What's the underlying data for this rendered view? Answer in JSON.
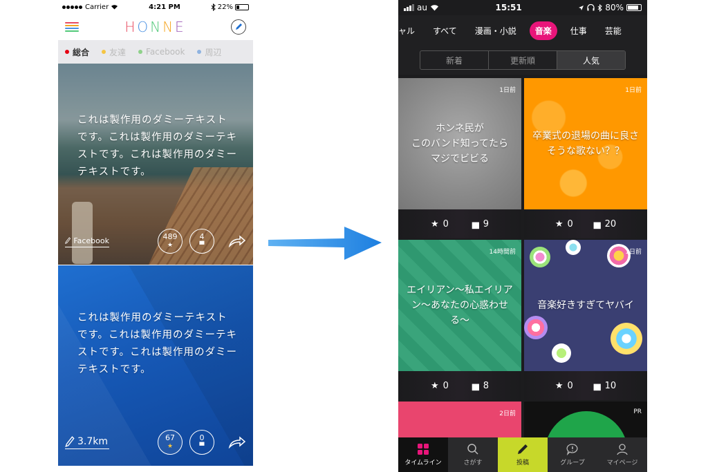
{
  "left": {
    "status": {
      "carrier": "Carrier",
      "time": "4:21 PM",
      "battery": "22%"
    },
    "logo": "HONNE",
    "logo_colors": [
      "#e84a5f",
      "#4a90e2",
      "#50c878",
      "#f5a623",
      "#9b59b6"
    ],
    "filters": [
      {
        "label": "総合",
        "color": "#e60012",
        "active": true
      },
      {
        "label": "友達",
        "color": "#f5c542",
        "active": false
      },
      {
        "label": "Facebook",
        "color": "#8fd18a",
        "active": false
      },
      {
        "label": "周辺",
        "color": "#8fb3e0",
        "active": false
      }
    ],
    "cards": [
      {
        "text": "これは製作用のダミーテキストです。これは製作用のダミーテキストです。これは製作用のダミーテキストです。",
        "tag": "Facebook",
        "likes": "489",
        "comments": "4"
      },
      {
        "text": "これは製作用のダミーテキストです。これは製作用のダミーテキストです。これは製作用のダミーテキストです。",
        "tag": "3.7km",
        "likes": "67",
        "comments": "0"
      }
    ]
  },
  "right": {
    "status": {
      "carrier": "au",
      "time": "15:51",
      "battery": "80%"
    },
    "categories": [
      "ャル",
      "すべて",
      "漫画・小説",
      "音楽",
      "仕事",
      "芸能"
    ],
    "active_category": "音楽",
    "segments": [
      "新着",
      "更新順",
      "人気"
    ],
    "active_segment": "人気",
    "posts": [
      {
        "text": "ホンネ民が\nこのバンド知ってたら\nマジでビビる",
        "age": "1日前",
        "stars": "0",
        "comments": "9"
      },
      {
        "text": "卒業式の退場の曲に良さそうな歌ない？？",
        "age": "1日前",
        "stars": "0",
        "comments": "20"
      },
      {
        "text": "エイリアン〜私エイリアン〜あなたの心惑わせる〜",
        "age": "14時間前",
        "stars": "0",
        "comments": "8"
      },
      {
        "text": "音楽好きすぎてヤバイ",
        "age": "1日前",
        "stars": "0",
        "comments": "10"
      },
      {
        "text": "",
        "age": "2日前",
        "stars": "",
        "comments": ""
      },
      {
        "text": "",
        "age": "PR",
        "stars": "",
        "comments": ""
      }
    ],
    "tabs": [
      "タイムライン",
      "さがす",
      "投稿",
      "グループ",
      "マイページ"
    ]
  }
}
